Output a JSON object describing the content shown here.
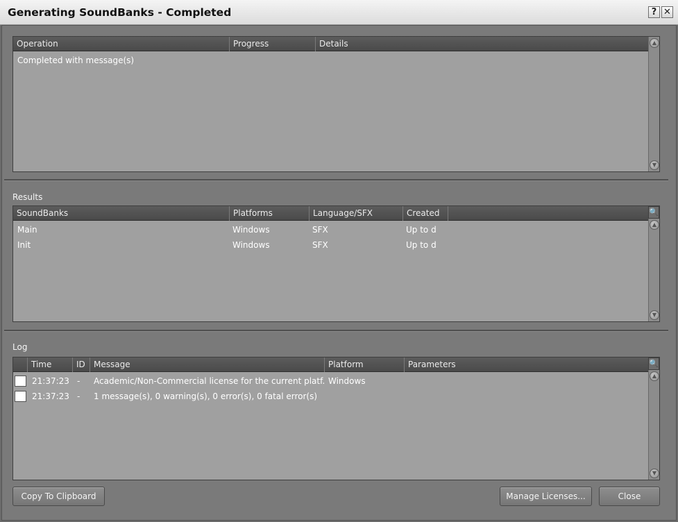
{
  "window": {
    "title": "Generating SoundBanks - Completed",
    "help_label": "?",
    "close_label": "✕"
  },
  "operations": {
    "columns": [
      "Operation",
      "Progress",
      "Details"
    ],
    "rows": [
      {
        "operation": "Completed with message(s)",
        "progress": "",
        "details": ""
      }
    ]
  },
  "results": {
    "label": "Results",
    "columns": [
      "SoundBanks",
      "Platforms",
      "Language/SFX",
      "Created"
    ],
    "rows": [
      {
        "soundbank": "Main",
        "platform": "Windows",
        "language": "SFX",
        "created": "Up to d"
      },
      {
        "soundbank": "Init",
        "platform": "Windows",
        "language": "SFX",
        "created": "Up to d"
      }
    ]
  },
  "log": {
    "label": "Log",
    "columns": [
      "",
      "Time",
      "ID",
      "Message",
      "Platform",
      "Parameters"
    ],
    "rows": [
      {
        "time": "21:37:23",
        "id": "-",
        "message": "Academic/Non-Commercial license for the current platf...",
        "platform": "Windows",
        "parameters": ""
      },
      {
        "time": "21:37:23",
        "id": "-",
        "message": "1 message(s), 0 warning(s), 0 error(s), 0 fatal error(s)",
        "platform": "",
        "parameters": ""
      }
    ]
  },
  "buttons": {
    "copy": "Copy To Clipboard",
    "manage": "Manage Licenses...",
    "close": "Close"
  },
  "icons": {
    "search": "magnifier-icon",
    "scroll_up": "scroll-up-icon",
    "scroll_down": "scroll-down-icon"
  }
}
